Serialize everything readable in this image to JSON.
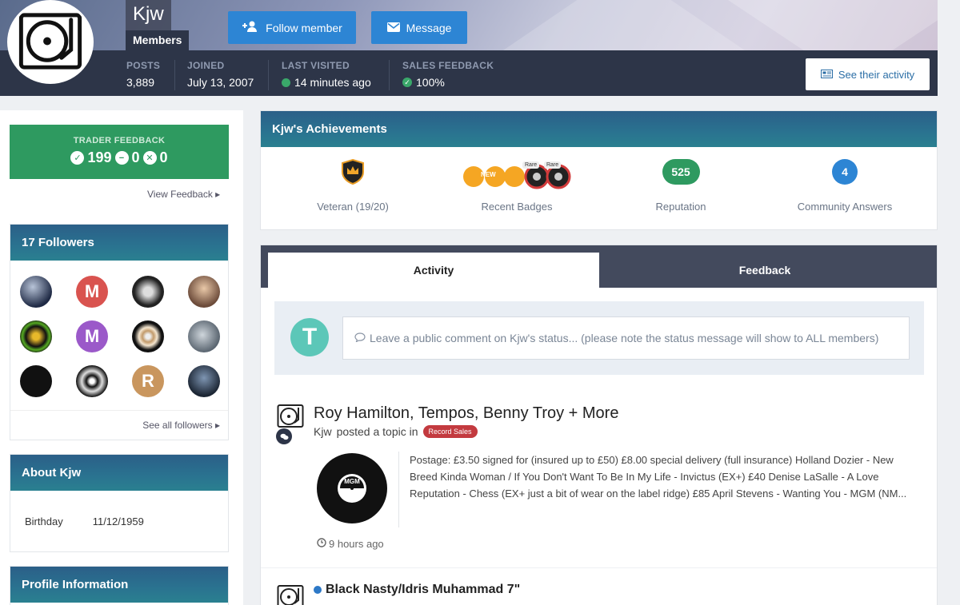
{
  "header": {
    "username": "Kjw",
    "usergroup": "Members",
    "follow_label": "Follow member",
    "message_label": "Message",
    "activity_label": "See their activity",
    "stats": [
      {
        "label": "POSTS",
        "value": "3,889"
      },
      {
        "label": "JOINED",
        "value": "July 13, 2007"
      },
      {
        "label": "LAST VISITED",
        "value": "14 minutes ago"
      },
      {
        "label": "SALES FEEDBACK",
        "value": "100%"
      }
    ]
  },
  "trader_feedback": {
    "label": "TRADER FEEDBACK",
    "positive": "199",
    "neutral": "0",
    "negative": "0",
    "view_link": "View Feedback"
  },
  "followers": {
    "title": "17 Followers",
    "see_all": "See all followers",
    "letters": [
      "M",
      "M",
      "R"
    ]
  },
  "about": {
    "title": "About Kjw",
    "birthday_label": "Birthday",
    "birthday_value": "11/12/1959"
  },
  "profile_info": {
    "title": "Profile Information"
  },
  "achievements": {
    "title": "Kjw's Achievements",
    "veteran": "Veteran (19/20)",
    "recent_badges": "Recent Badges",
    "new_badge": "NEW",
    "rare": "Rare",
    "reputation_value": "525",
    "reputation_label": "Reputation",
    "answers_value": "4",
    "answers_label": "Community Answers"
  },
  "tabs": {
    "activity": "Activity",
    "feedback": "Feedback"
  },
  "status": {
    "avatar_letter": "T",
    "placeholder": "Leave a public comment on Kjw's status... (please note the status message will show to ALL members)"
  },
  "posts": [
    {
      "title": "Roy Hamilton, Tempos, Benny Troy + More",
      "author": "Kjw",
      "action": "posted a topic in",
      "tag": "Record Sales",
      "excerpt": "Postage: £3.50 signed for (insured up to £50) £8.00 special delivery (full insurance) Holland Dozier - New Breed Kinda Woman / If You Don't Want To Be In My Life - Invictus (EX+) £40 Denise LaSalle - A Love Reputation - Chess (EX+ just a bit of wear on the label ridge) £85 April Stevens - Wanting You - MGM (NM...",
      "time": "9 hours ago",
      "label_text": "MGM"
    },
    {
      "title": "Black Nasty/Idris Muhammad 7\""
    }
  ],
  "colors": {
    "accent": "#2d85d4",
    "green": "#2e9a60",
    "dark": "#2d3548",
    "tag": "#c33a3f"
  }
}
